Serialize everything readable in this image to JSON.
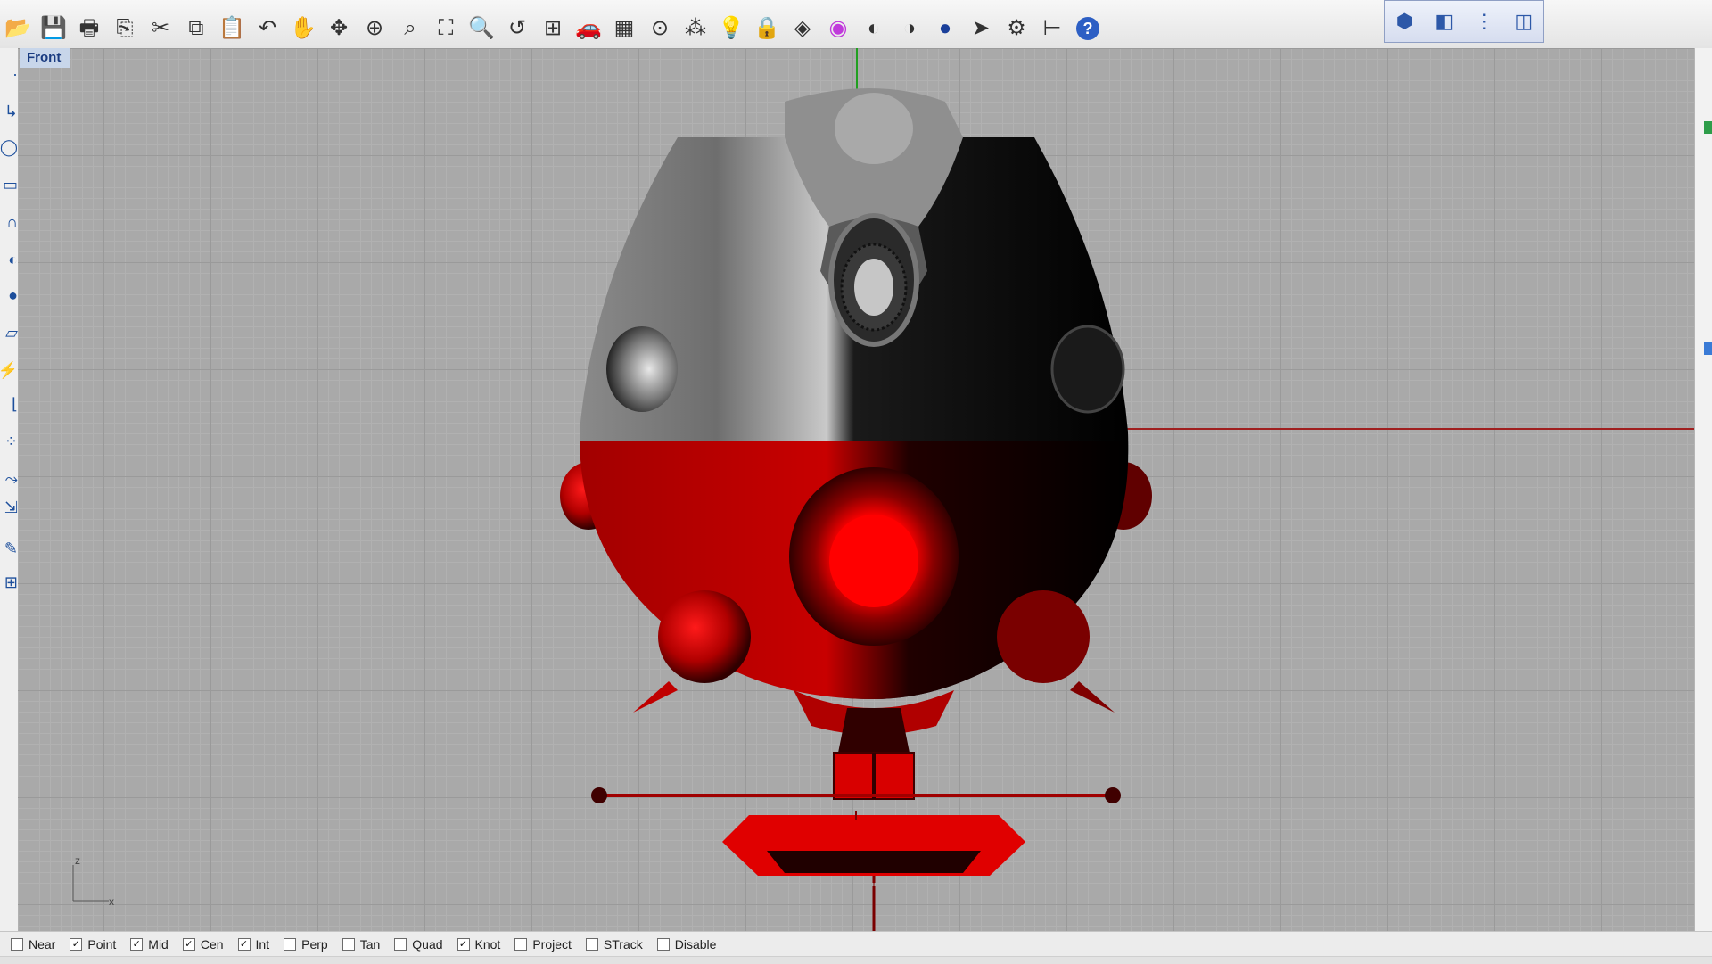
{
  "toolbar": {
    "icons": [
      "open-icon",
      "save-icon",
      "print-icon",
      "import-icon",
      "cut-icon",
      "copy-icon",
      "paste-icon",
      "undo-icon",
      "pan-icon",
      "rotate-view-icon",
      "zoom-icon",
      "zoom-window-icon",
      "zoom-extents-icon",
      "zoom-selected-icon",
      "undo-view-icon",
      "four-viewports-icon",
      "car-icon",
      "grid-icon",
      "point-icon",
      "control-points-icon",
      "lightbulb-icon",
      "lock-icon",
      "layer-icon",
      "color-wheel-icon",
      "shaded-icon",
      "rendered-icon",
      "render-sphere-icon",
      "flag-icon",
      "settings-icon",
      "dimension-icon",
      "help-icon"
    ],
    "glyphs": [
      "📂",
      "💾",
      "🖶",
      "⎘",
      "✂",
      "⧉",
      "📋",
      "↶",
      "✋",
      "✥",
      "⊕",
      "⌕",
      "⛶",
      "🔍",
      "↺",
      "⊞",
      "🚗",
      "▦",
      "⊙",
      "⁂",
      "💡",
      "🔒",
      "◈",
      "◉",
      "◐",
      "◑",
      "●",
      "➤",
      "⚙",
      "⊢",
      "?"
    ],
    "view_icons": [
      "perspective-view-icon",
      "top-view-icon",
      "front-view-icon",
      "right-view-icon"
    ],
    "view_glyphs": [
      "⬢",
      "◧",
      "⋮",
      "◫"
    ]
  },
  "viewport": {
    "label": "Front",
    "axis_labels": {
      "z": "z",
      "x": "x"
    },
    "colors": {
      "grid": "#a9a9a9",
      "x_axis": "#a02020",
      "y_axis": "#20a020",
      "teal": "#2fa3a8",
      "red": "#e00000"
    }
  },
  "osnaps": [
    {
      "label": "Near",
      "checked": false
    },
    {
      "label": "Point",
      "checked": true
    },
    {
      "label": "Mid",
      "checked": true
    },
    {
      "label": "Cen",
      "checked": true
    },
    {
      "label": "Int",
      "checked": true
    },
    {
      "label": "Perp",
      "checked": false
    },
    {
      "label": "Tan",
      "checked": false
    },
    {
      "label": "Quad",
      "checked": false
    },
    {
      "label": "Knot",
      "checked": true
    },
    {
      "label": "Project",
      "checked": false
    },
    {
      "label": "STrack",
      "checked": false
    },
    {
      "label": "Disable",
      "checked": false
    }
  ]
}
